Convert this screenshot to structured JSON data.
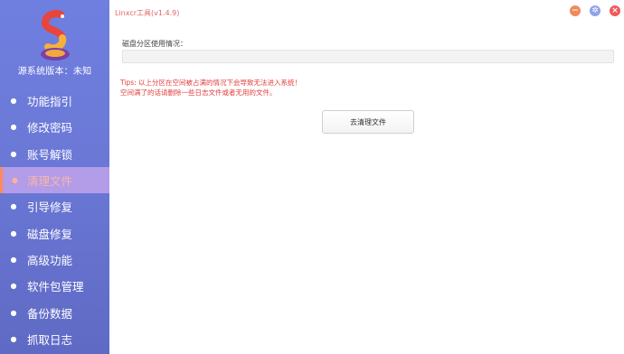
{
  "app": {
    "title": "Linxcr工具(v1.4.9)",
    "system_version_label": "源系统版本：未知"
  },
  "sidebar": {
    "items": [
      {
        "label": "功能指引",
        "icon": "pin-icon",
        "active": false
      },
      {
        "label": "修改密码",
        "icon": "pin-icon",
        "active": false
      },
      {
        "label": "账号解锁",
        "icon": "pin-icon",
        "active": false
      },
      {
        "label": "清理文件",
        "icon": "pin-icon",
        "active": true
      },
      {
        "label": "引导修复",
        "icon": "pin-icon",
        "active": false
      },
      {
        "label": "磁盘修复",
        "icon": "pin-icon",
        "active": false
      },
      {
        "label": "高级功能",
        "icon": "pin-icon",
        "active": false
      },
      {
        "label": "软件包管理",
        "icon": "pin-icon",
        "active": false
      },
      {
        "label": "备份数据",
        "icon": "pin-icon",
        "active": false
      },
      {
        "label": "抓取日志",
        "icon": "pin-icon",
        "active": false
      }
    ]
  },
  "main": {
    "disk_usage_label": "磁盘分区使用情况：",
    "disk_usage_fraction": 0,
    "tips_line1": "Tips: 以上分区在空间被占满的情况下会导致无法进入系统！",
    "tips_line2": "空间满了的话请删除一些日志文件或者无用的文件。",
    "clean_button_label": "去清理文件"
  },
  "window_controls": {
    "minimize_symbol": "−",
    "settings_symbol": "✲",
    "close_symbol": "×"
  },
  "colors": {
    "sidebar": "#6b78d6",
    "active_item_bg": "#b39ce8",
    "tips": "#e23d3d",
    "title": "#e06565"
  }
}
